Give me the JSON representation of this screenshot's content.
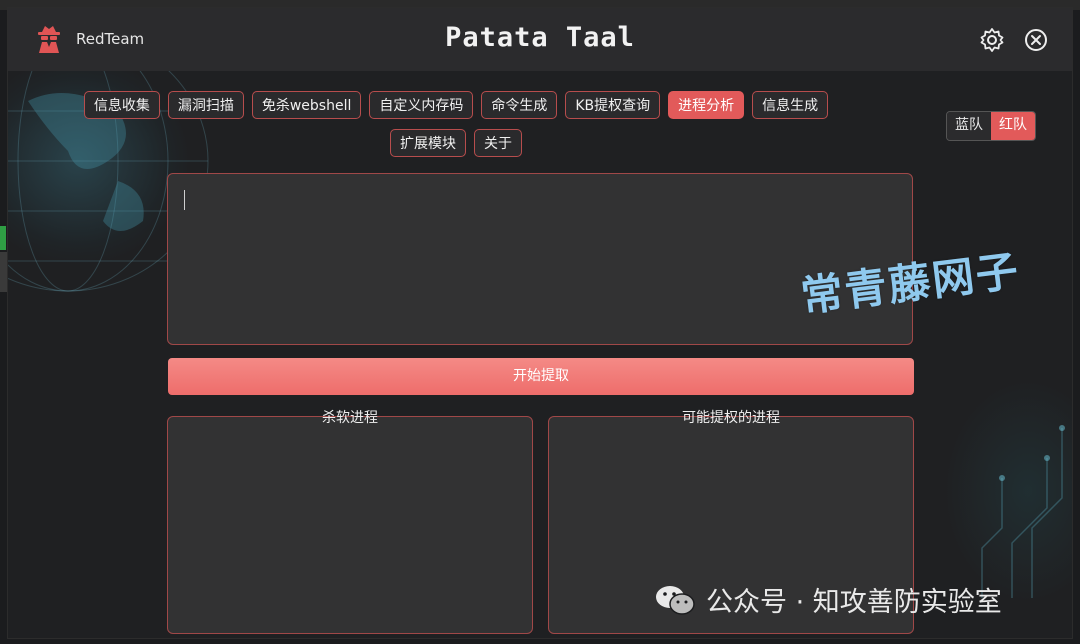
{
  "window": {
    "brand": {
      "label": "RedTeam",
      "icon": "spy-icon"
    },
    "title": "Patata Taal",
    "controls": {
      "settings_icon": "gear-icon",
      "close_icon": "close-circle-icon"
    }
  },
  "tabs_row1": [
    "信息收集",
    "漏洞扫描",
    "免杀webshell",
    "自定义内存码",
    "命令生成",
    "KB提权查询",
    "进程分析",
    "信息生成"
  ],
  "tabs_row2": [
    "扩展模块",
    "关于"
  ],
  "active_tab": "进程分析",
  "team_toggle": {
    "blue": "蓝队",
    "red": "红队",
    "selected": "红队"
  },
  "input": {
    "value": ""
  },
  "start_button": {
    "label": "开始提取"
  },
  "panels": {
    "left_title": "杀软进程",
    "right_title": "可能提权的进程"
  },
  "watermarks": {
    "overlay": "常青藤网子",
    "wechat": "公众号 · 知攻善防实验室"
  },
  "colors": {
    "accent": "#e25a5a",
    "border": "#a04848",
    "button": "#ee6d6b"
  }
}
